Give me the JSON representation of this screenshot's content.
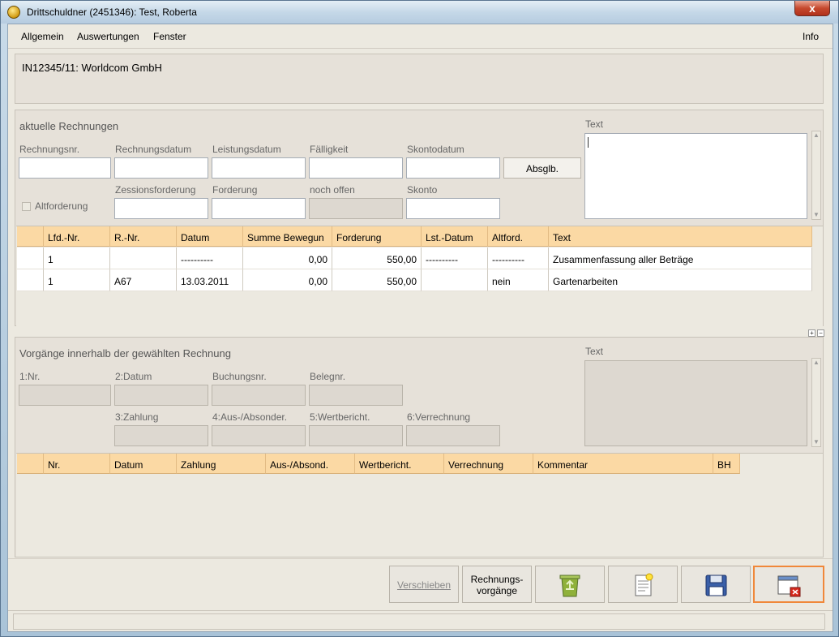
{
  "window": {
    "title": "Drittschuldner (2451346): Test, Roberta",
    "close_glyph": "x"
  },
  "menu": {
    "items": [
      "Allgemein",
      "Auswertungen",
      "Fenster"
    ],
    "info": "Info"
  },
  "case_title": "IN12345/11: Worldcom GmbH",
  "invoices": {
    "section_title": "aktuelle Rechnungen",
    "text_label": "Text",
    "labels": {
      "rechnungsnr": "Rechnungsnr.",
      "rechnungsdatum": "Rechnungsdatum",
      "leistungsdatum": "Leistungsdatum",
      "faelligkeit": "Fälligkeit",
      "skontodatum": "Skontodatum",
      "zessionsforderung": "Zessionsforderung",
      "forderung": "Forderung",
      "noch_offen": "noch offen",
      "skonto": "Skonto",
      "altforderung": "Altforderung"
    },
    "absglb_label": "Absglb.",
    "columns": [
      "",
      "Lfd.-Nr.",
      "R.-Nr.",
      "Datum",
      "Summe Bewegun",
      "Forderung",
      "Lst.-Datum",
      "Altford.",
      "Text"
    ],
    "rows": [
      [
        "",
        "1",
        "",
        "----------",
        "0,00",
        "550,00",
        "----------",
        "----------",
        "Zusammenfassung aller Beträge"
      ],
      [
        "",
        "1",
        "A67",
        "13.03.2011",
        "0,00",
        "550,00",
        "",
        "nein",
        "Gartenarbeiten"
      ]
    ]
  },
  "splitter": {
    "plus": "+",
    "minus": "−"
  },
  "transactions": {
    "section_title": "Vorgänge innerhalb der gewählten Rechnung",
    "text_label": "Text",
    "labels": {
      "nr": "1:Nr.",
      "datum": "2:Datum",
      "buchungsnr": "Buchungsnr.",
      "belegnr": "Belegnr.",
      "zahlung": "3:Zahlung",
      "aus_absonder": "4:Aus-/Absonder.",
      "wertbericht": "5:Wertbericht.",
      "verrechnung": "6:Verrechnung"
    },
    "columns": [
      "",
      "Nr.",
      "Datum",
      "Zahlung",
      "Aus-/Absond.",
      "Wertbericht.",
      "Verrechnung",
      "Kommentar",
      "BH"
    ]
  },
  "buttons": {
    "verschieben": "Verschieben",
    "rechnungsvorgaenge_1": "Rechnungs-",
    "rechnungsvorgaenge_2": "vorgänge",
    "recycle_icon": "recycle-bin-icon",
    "new_doc_icon": "new-document-icon",
    "save_icon": "floppy-disk-icon",
    "close_icon": "close-window-icon"
  }
}
